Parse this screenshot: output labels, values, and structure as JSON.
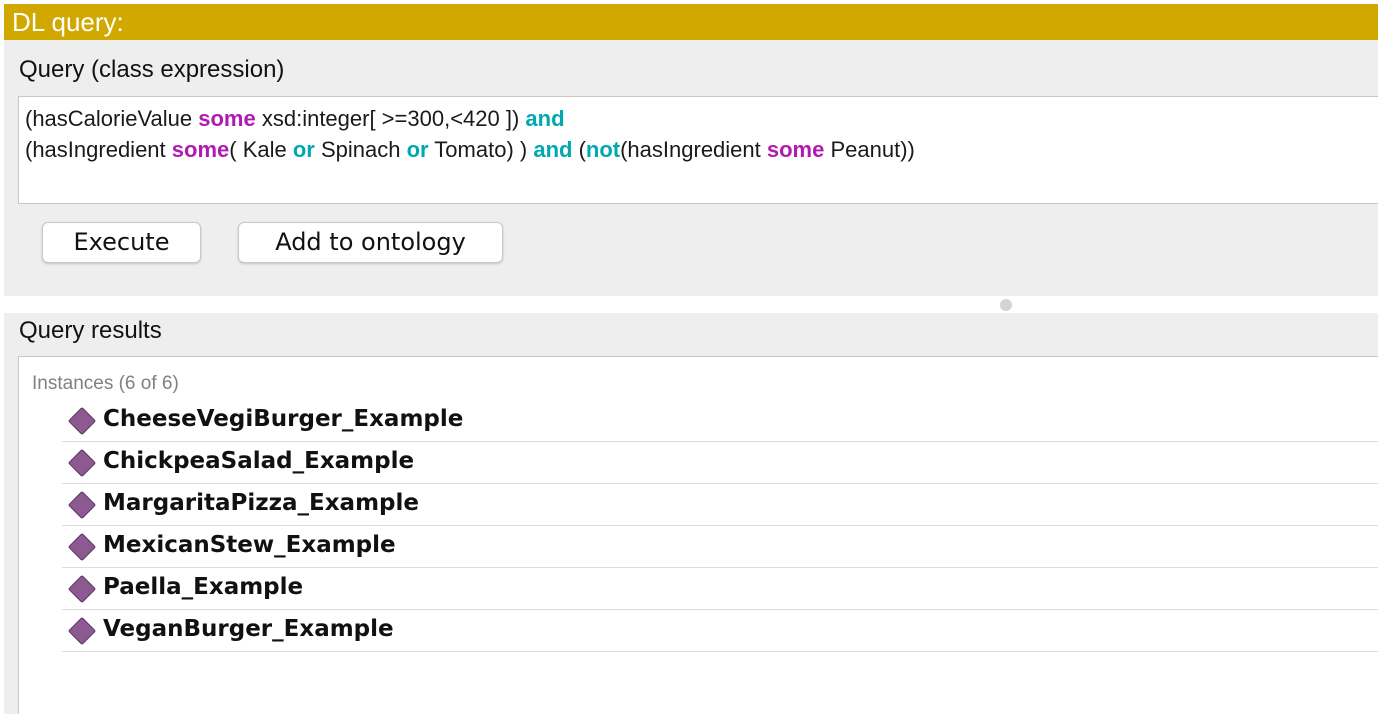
{
  "window": {
    "title": "DL query:"
  },
  "query": {
    "section_label": "Query (class expression)",
    "line1": [
      {
        "text": "(hasCalorieValue ",
        "style": "plain"
      },
      {
        "text": "some",
        "style": "purple"
      },
      {
        "text": " xsd:integer[ >=300,<420 ]) ",
        "style": "plain"
      },
      {
        "text": "and",
        "style": "teal"
      }
    ],
    "line2": [
      {
        "text": "(hasIngredient ",
        "style": "plain"
      },
      {
        "text": "some",
        "style": "purple"
      },
      {
        "text": "( Kale ",
        "style": "plain"
      },
      {
        "text": "or",
        "style": "teal"
      },
      {
        "text": " Spinach ",
        "style": "plain"
      },
      {
        "text": "or",
        "style": "teal"
      },
      {
        "text": " Tomato) ) ",
        "style": "plain"
      },
      {
        "text": "and",
        "style": "teal"
      },
      {
        "text": " (",
        "style": "plain"
      },
      {
        "text": "not",
        "style": "teal"
      },
      {
        "text": "(hasIngredient ",
        "style": "plain"
      },
      {
        "text": "some",
        "style": "purple"
      },
      {
        "text": " Peanut))",
        "style": "plain"
      }
    ]
  },
  "buttons": {
    "execute": "Execute",
    "add_to_ontology": "Add to ontology"
  },
  "results": {
    "section_label": "Query results",
    "instances_header": "Instances (6 of 6)",
    "icon": "individual-diamond-icon",
    "items": [
      "CheeseVegiBurger_Example",
      "ChickpeaSalad_Example",
      "MargaritaPizza_Example",
      "MexicanStew_Example",
      "Paella_Example",
      "VeganBurger_Example"
    ]
  },
  "colors": {
    "title_bar": "#d1a800",
    "keyword_purple": "#b01ab0",
    "keyword_teal": "#00a8b0",
    "individual_icon": "#8c5a90"
  }
}
